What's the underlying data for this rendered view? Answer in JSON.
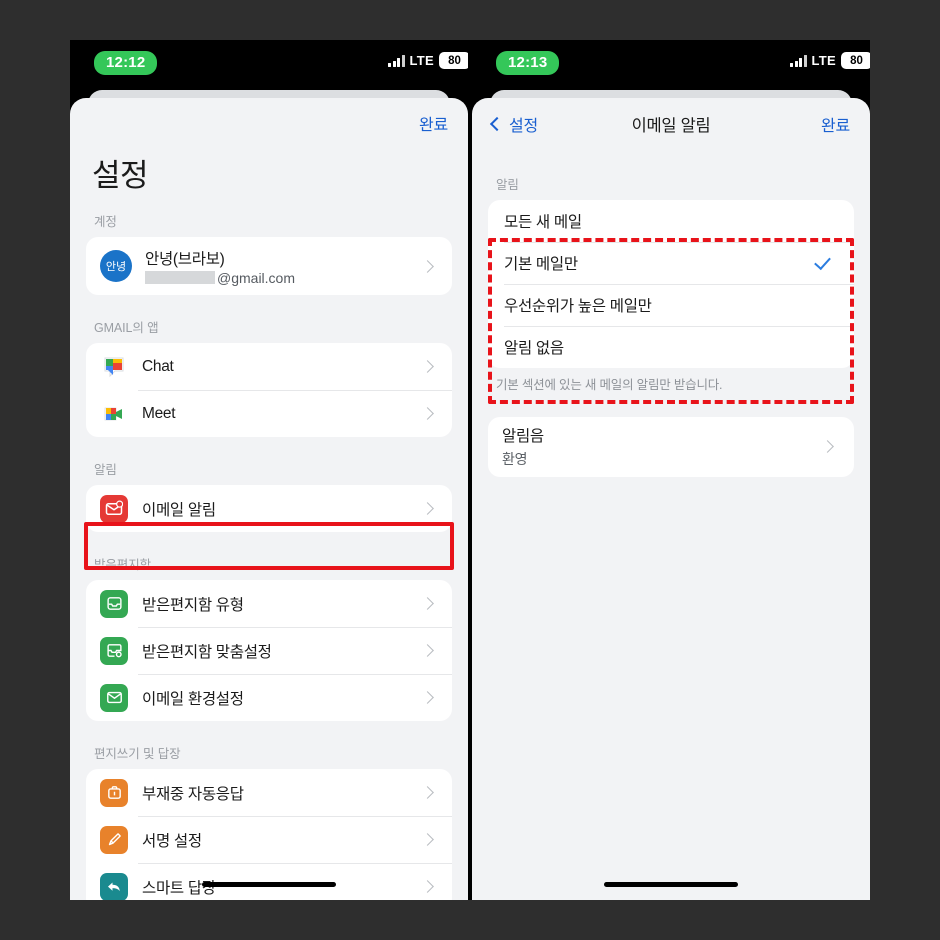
{
  "left_phone": {
    "status": {
      "time": "12:12",
      "network": "LTE",
      "battery": "80"
    },
    "done_label": "완료",
    "title": "설정",
    "sections": [
      {
        "label": "계정",
        "account": {
          "avatar_initials": "안녕",
          "name": "안녕(브라보)",
          "email_suffix": "@gmail.com"
        }
      },
      {
        "label": "GMAIL의 앱",
        "rows": [
          {
            "label": "Chat",
            "icon": "google-chat-icon"
          },
          {
            "label": "Meet",
            "icon": "google-meet-icon"
          }
        ]
      },
      {
        "label": "알림",
        "rows": [
          {
            "label": "이메일 알림",
            "icon": "mail-notification-icon"
          }
        ]
      },
      {
        "label": "받은편지함",
        "rows": [
          {
            "label": "받은편지함 유형",
            "icon": "inbox-icon"
          },
          {
            "label": "받은편지함 맞춤설정",
            "icon": "inbox-gear-icon"
          },
          {
            "label": "이메일 환경설정",
            "icon": "envelope-icon"
          }
        ]
      },
      {
        "label": "편지쓰기 및 답장",
        "rows": [
          {
            "label": "부재중 자동응답",
            "icon": "briefcase-icon"
          },
          {
            "label": "서명 설정",
            "icon": "pen-icon"
          },
          {
            "label": "스마트 답장",
            "icon": "reply-arrow-icon"
          }
        ]
      }
    ]
  },
  "right_phone": {
    "status": {
      "time": "12:13",
      "network": "LTE",
      "battery": "80"
    },
    "back_label": "설정",
    "title": "이메일 알림",
    "done_label": "완료",
    "section_label": "알림",
    "options": [
      {
        "label": "모든 새 메일",
        "selected": false
      },
      {
        "label": "기본 메일만",
        "selected": true
      },
      {
        "label": "우선순위가 높은 메일만",
        "selected": false
      },
      {
        "label": "알림 없음",
        "selected": false
      }
    ],
    "footnote": "기본 섹션에 있는 새 메일의 알림만 받습니다.",
    "sound_row": {
      "title": "알림음",
      "value": "환영"
    }
  },
  "highlight_color": "#e8131a"
}
